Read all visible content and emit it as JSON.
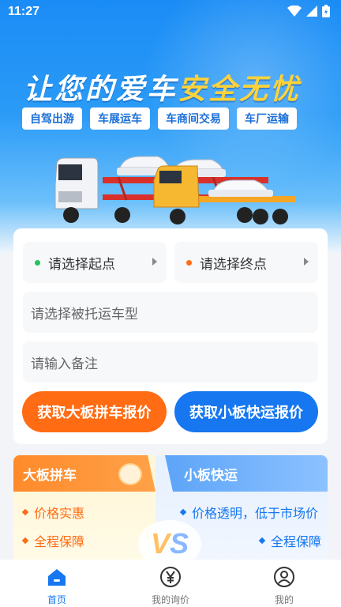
{
  "status": {
    "time": "11:27"
  },
  "hero": {
    "headline_main": "让您的爱车",
    "headline_accent": "安全无忧",
    "chips": [
      "自驾出游",
      "车展运车",
      "车商间交易",
      "车厂运输"
    ]
  },
  "form": {
    "origin_placeholder": "请选择起点",
    "destination_placeholder": "请选择终点",
    "vehicle_type_placeholder": "请选择被托运车型",
    "remark_placeholder": "请输入备注",
    "btn_large_board": "获取大板拼车报价",
    "btn_small_board": "获取小板快运报价"
  },
  "compare": {
    "left_title": "大板拼车",
    "left_points": [
      "价格实惠",
      "全程保障"
    ],
    "right_title": "小板快运",
    "right_points": [
      "价格透明，低于市场价",
      "全程保障"
    ],
    "vs_v": "V",
    "vs_s": "S"
  },
  "tabbar": {
    "items": [
      {
        "label": "首页",
        "icon": "home-icon",
        "active": true
      },
      {
        "label": "我的询价",
        "icon": "yen-icon",
        "active": false
      },
      {
        "label": "我的",
        "icon": "user-icon",
        "active": false
      }
    ]
  },
  "colors": {
    "accent_orange": "#ff6c14",
    "accent_blue": "#1677f0",
    "headline_yellow": "#ffd23a"
  }
}
